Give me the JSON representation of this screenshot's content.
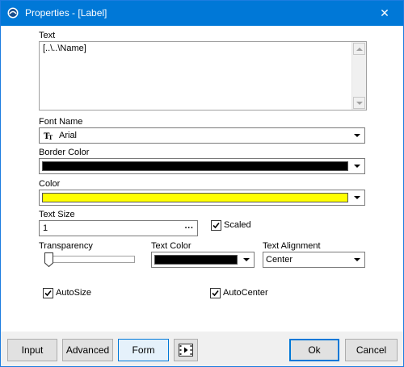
{
  "window": {
    "title": "Properties - [Label]",
    "close_glyph": "✕"
  },
  "text_field": {
    "label": "Text",
    "value": "[..\\..\\Name]"
  },
  "font": {
    "label": "Font Name",
    "value": "Arial",
    "icon": "font-icon"
  },
  "border_color": {
    "label": "Border Color",
    "color": "#000000"
  },
  "color": {
    "label": "Color",
    "color": "#ffff00"
  },
  "text_size": {
    "label": "Text Size",
    "value": "1",
    "button": "···"
  },
  "scaled": {
    "label": "Scaled",
    "checked": true
  },
  "transparency": {
    "label": "Transparency",
    "value": 0
  },
  "text_color": {
    "label": "Text Color",
    "color": "#000000"
  },
  "text_alignment": {
    "label": "Text Alignment",
    "value": "Center"
  },
  "autosize": {
    "label": "AutoSize",
    "checked": true
  },
  "autocenter": {
    "label": "AutoCenter",
    "checked": true
  },
  "footer": {
    "input_label": "Input",
    "advanced_label": "Advanced",
    "form_label": "Form",
    "ok_label": "Ok",
    "cancel_label": "Cancel"
  },
  "colors": {
    "titlebar": "#0078d7",
    "accent": "#0078d7"
  }
}
